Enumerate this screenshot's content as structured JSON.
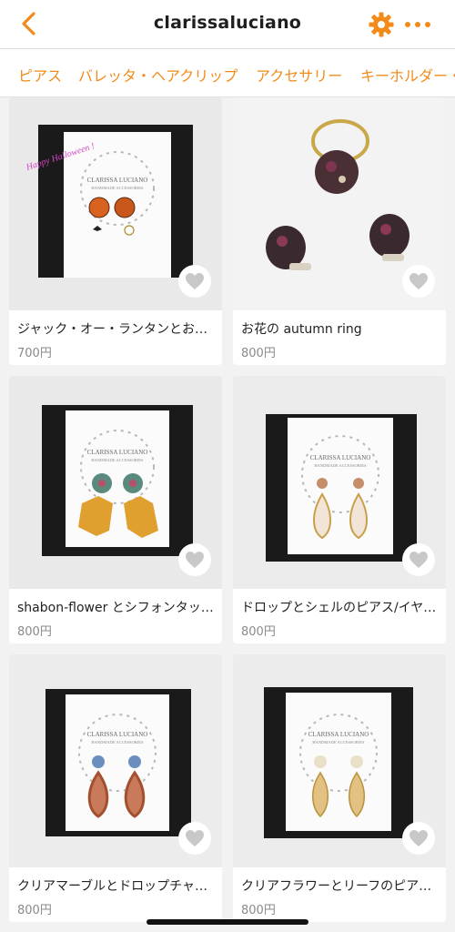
{
  "header": {
    "title": "clarissaluciano",
    "accent": "#f28b1a",
    "icons": {
      "back": "chevron-left-icon",
      "settings": "gear-icon",
      "more": "more-dots-icon"
    }
  },
  "tabs": [
    {
      "label": "ピアス"
    },
    {
      "label": "バレッタ・ヘアクリップ"
    },
    {
      "label": "アクセサリー"
    },
    {
      "label": "キーホルダー・"
    }
  ],
  "products": [
    {
      "title": "ジャック・オー・ランタンとお…",
      "price": "700円"
    },
    {
      "title": "お花の autumn ring",
      "price": "800円"
    },
    {
      "title": "shabon-flower とシフォンタッ…",
      "price": "800円"
    },
    {
      "title": "ドロップとシェルのピアス/イヤ…",
      "price": "800円"
    },
    {
      "title": "クリアマーブルとドロップチャ…",
      "price": "800円"
    },
    {
      "title": "クリアフラワーとリーフのピア…",
      "price": "800円"
    }
  ],
  "product_images": [
    {
      "card_brand": "CLARISSA LUCIANO",
      "card_sub": "HANDMADE ACCESSORIES",
      "banner": "Happy Halloween !"
    },
    {
      "card_brand": "",
      "card_sub": "",
      "banner": ""
    },
    {
      "card_brand": "CLARISSA LUCIANO",
      "card_sub": "HANDMADE ACCESSORIES",
      "banner": ""
    },
    {
      "card_brand": "CLARISSA LUCIANO",
      "card_sub": "HANDMADE ACCESSORIES",
      "banner": ""
    },
    {
      "card_brand": "CLARISSA LUCIANO",
      "card_sub": "HANDMADE ACCESSORIES",
      "banner": ""
    },
    {
      "card_brand": "CLARISSA LUCIANO",
      "card_sub": "HANDMADE ACCESSORIES",
      "banner": ""
    }
  ]
}
